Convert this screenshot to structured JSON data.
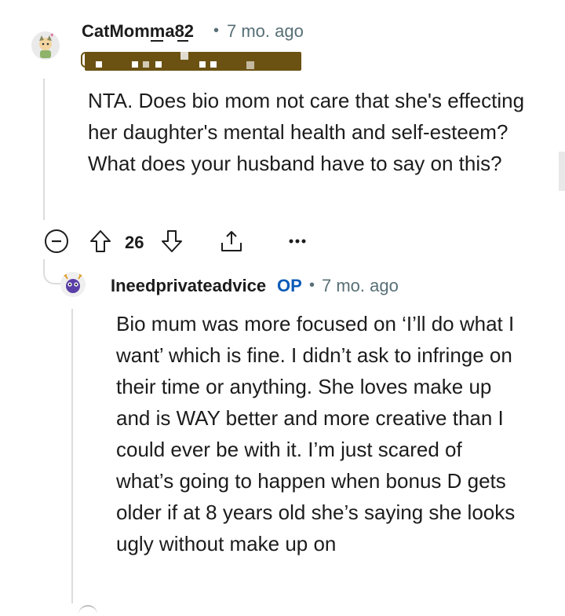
{
  "comments": [
    {
      "author": "CatMomma82",
      "separator": "•",
      "time": "7 mo. ago",
      "body": "NTA. Does bio mom not care that she's effecting her daughter's mental health and self-esteem? What does your husband have to say on this?",
      "votes": "26",
      "avatar_icon": "cat-avatar-icon"
    },
    {
      "author": "Ineedprivateadvice",
      "op_badge": "OP",
      "separator": "•",
      "time": "7 mo. ago",
      "body": "Bio mum was more focused on ‘I’ll do what I want’ which is fine. I didn’t ask to infringe on their time or anything. She loves make up and is WAY better and more creative than I could ever be with it. I’m just scared of what’s going to happen when bonus D gets older if at 8 years old she’s saying she looks ugly without make up on",
      "avatar_icon": "alien-avatar-icon"
    }
  ],
  "colors": {
    "text": "#1c1c1c",
    "meta": "#576f76",
    "op": "#0a5bb8",
    "thread": "#dcdcdc",
    "flair": "#6b5213"
  }
}
